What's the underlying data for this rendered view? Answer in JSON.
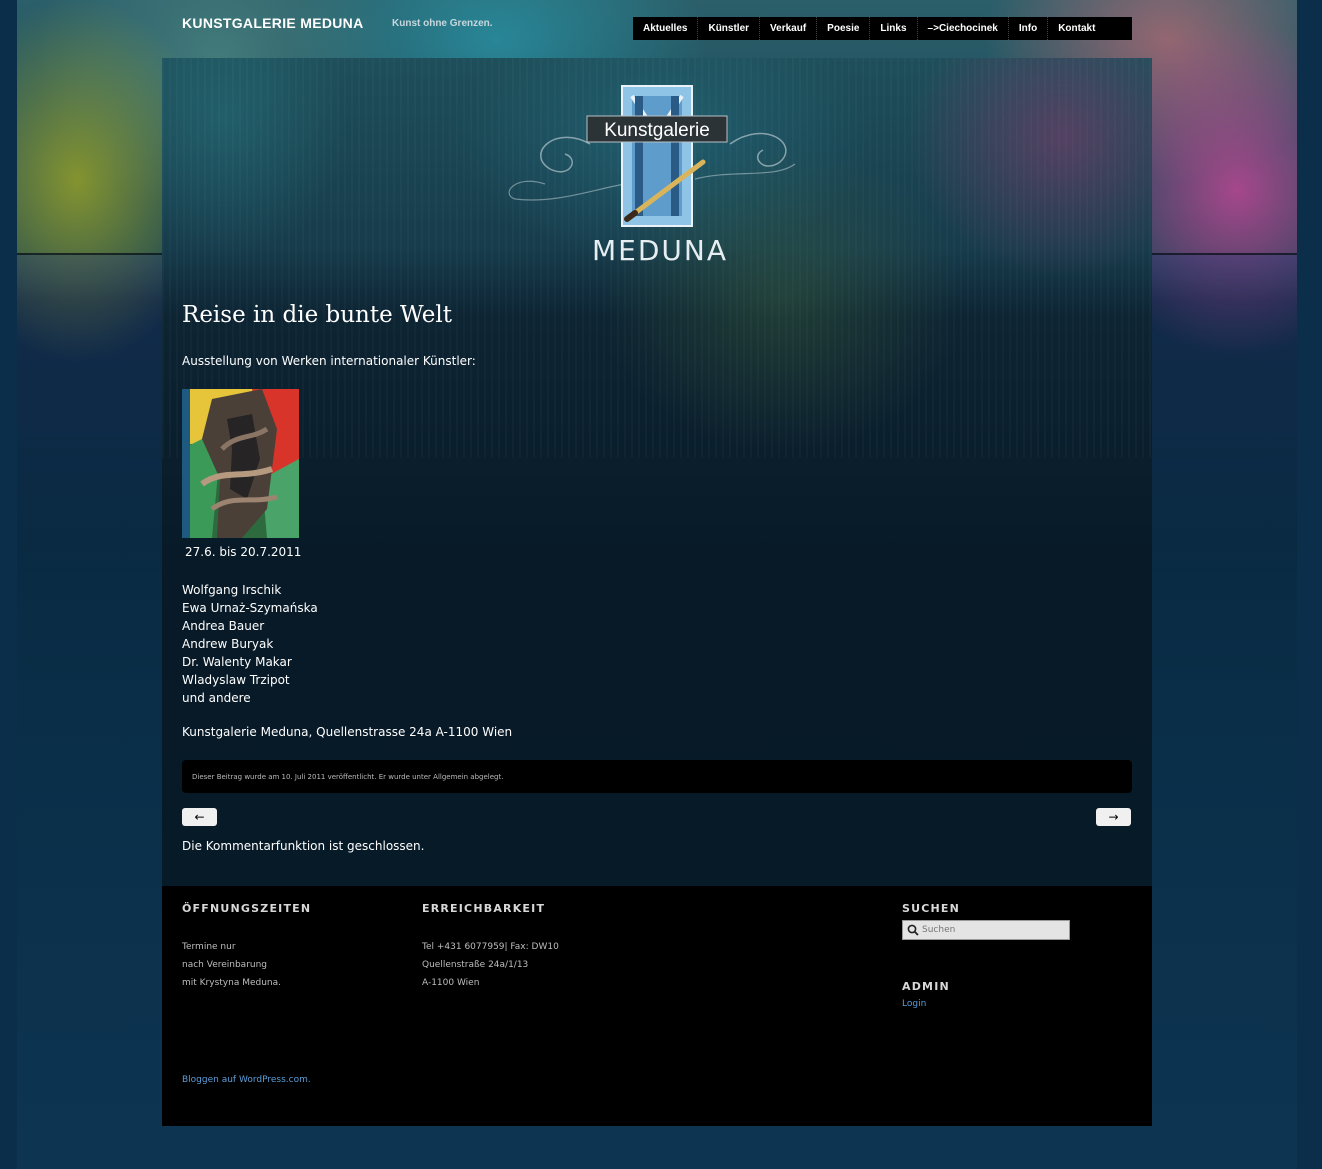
{
  "header": {
    "site_title": "KUNSTGALERIE MEDUNA",
    "site_description": "Kunst ohne Grenzen."
  },
  "nav": {
    "items": [
      "Aktuelles",
      "Künstler",
      "Verkauf",
      "Poesie",
      "Links",
      "–>Ciechocinek",
      "Info",
      "Kontakt"
    ]
  },
  "logo": {
    "top_text": "Kunstgalerie",
    "bottom_text": "MEDUNA"
  },
  "post": {
    "title": "Reise in die bunte Welt",
    "intro": "Ausstellung von Werken internationaler Künstler:",
    "dates": "27.6. bis 20.7.2011",
    "artists": [
      "Wolfgang Irschik",
      "Ewa Urnaż-Szymańska",
      "Andrea Bauer",
      "Andrew Buryak",
      "Dr. Walenty Makar",
      "Wladyslaw Trzipot",
      "und andere"
    ],
    "address": "Kunstgalerie Meduna, Quellenstrasse 24a A-1100 Wien",
    "meta": "Dieser Beitrag wurde am 10. Juli 2011 veröffentlicht. Er wurde unter Allgemein abgelegt.",
    "prev_label": "←",
    "next_label": "→",
    "comments_closed": "Die Kommentarfunktion ist geschlossen."
  },
  "footer": {
    "hours": {
      "title": "ÖFFNUNGSZEITEN",
      "lines": [
        "Termine nur",
        "nach Vereinbarung",
        "mit Krystyna Meduna."
      ]
    },
    "contact": {
      "title": "ERREICHBARKEIT",
      "lines": [
        "Tel +431 6077959| Fax: DW10",
        "Quellenstraße 24a/1/13",
        "A-1100 Wien"
      ]
    },
    "search": {
      "title": "SUCHEN",
      "placeholder": "Suchen"
    },
    "admin": {
      "title": "ADMIN",
      "login": "Login"
    },
    "credit": "Bloggen auf WordPress.com."
  },
  "colors": {
    "link": "#5b9dd9",
    "footer_bg": "#000000",
    "page_bg": "#0b2f4a"
  }
}
